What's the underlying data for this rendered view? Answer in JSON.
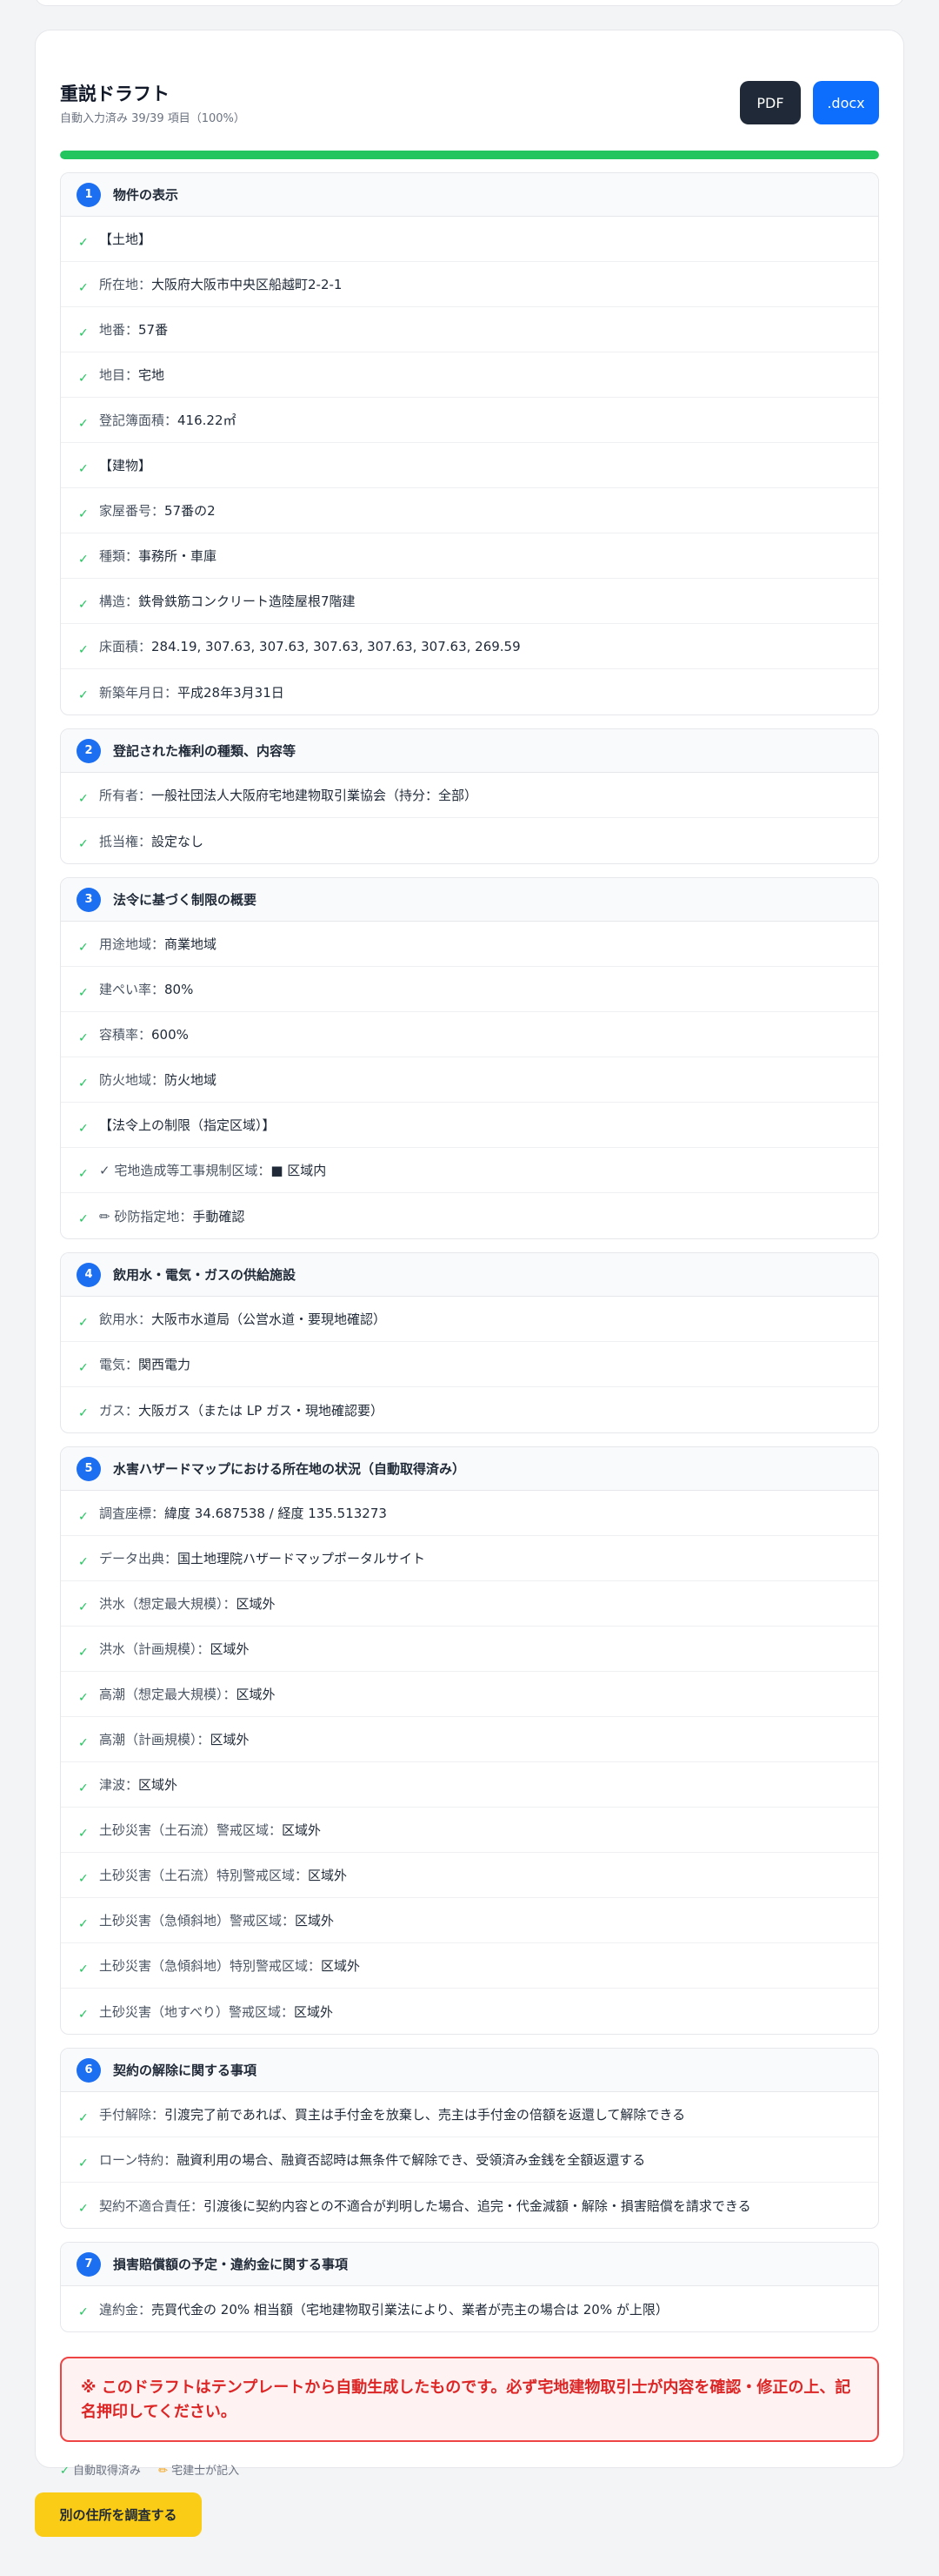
{
  "draft": {
    "title": "重説ドラフト",
    "subtitle": "自動入力済み 39/39 項目（100%）",
    "progress_percent": 100,
    "pdf_label": "PDF",
    "docx_label": ".docx"
  },
  "sections": [
    {
      "num": "1",
      "title": "物件の表示",
      "rows": [
        {
          "text": "【土地】"
        },
        {
          "label": "所在地：",
          "value": "大阪府大阪市中央区船越町2-2-1"
        },
        {
          "label": "地番：",
          "value": "57番"
        },
        {
          "label": "地目：",
          "value": "宅地"
        },
        {
          "label": "登記簿面積：",
          "value": "416.22㎡"
        },
        {
          "text": "【建物】"
        },
        {
          "label": "家屋番号：",
          "value": "57番の2"
        },
        {
          "label": "種類：",
          "value": "事務所・車庫"
        },
        {
          "label": "構造：",
          "value": "鉄骨鉄筋コンクリート造陸屋根7階建"
        },
        {
          "label": "床面積：",
          "value": "284.19, 307.63, 307.63, 307.63, 307.63, 307.63, 269.59"
        },
        {
          "label": "新築年月日：",
          "value": "平成28年3月31日"
        }
      ]
    },
    {
      "num": "2",
      "title": "登記された権利の種類、内容等",
      "rows": [
        {
          "label": "所有者：",
          "value": "一般社団法人大阪府宅地建物取引業協会（持分：全部）"
        },
        {
          "label": "抵当権：",
          "value": "設定なし"
        }
      ]
    },
    {
      "num": "3",
      "title": "法令に基づく制限の概要",
      "rows": [
        {
          "label": "用途地域：",
          "value": "商業地域"
        },
        {
          "label": "建ぺい率：",
          "value": "80%"
        },
        {
          "label": "容積率：",
          "value": "600%"
        },
        {
          "label": "防火地域：",
          "value": "防火地域"
        },
        {
          "text": "【法令上の制限（指定区域）】"
        },
        {
          "label": "✓ 宅地造成等工事規制区域：",
          "value": "■ 区域内"
        },
        {
          "label": "✏ 砂防指定地：",
          "value": "手動確認"
        }
      ]
    },
    {
      "num": "4",
      "title": "飲用水・電気・ガスの供給施設",
      "rows": [
        {
          "label": "飲用水：",
          "value": "大阪市水道局（公営水道・要現地確認）"
        },
        {
          "label": "電気：",
          "value": "関西電力"
        },
        {
          "label": "ガス：",
          "value": "大阪ガス（または LP ガス・現地確認要）"
        }
      ]
    },
    {
      "num": "5",
      "title": "水害ハザードマップにおける所在地の状況（自動取得済み）",
      "rows": [
        {
          "label": "調査座標：",
          "value": "緯度 34.687538 / 経度 135.513273"
        },
        {
          "label": "データ出典：",
          "value": "国土地理院ハザードマップポータルサイト"
        },
        {
          "label": "洪水（想定最大規模）：",
          "value": "区域外"
        },
        {
          "label": "洪水（計画規模）：",
          "value": "区域外"
        },
        {
          "label": "高潮（想定最大規模）：",
          "value": "区域外"
        },
        {
          "label": "高潮（計画規模）：",
          "value": "区域外"
        },
        {
          "label": "津波：",
          "value": "区域外"
        },
        {
          "label": "土砂災害（土石流）警戒区域：",
          "value": "区域外"
        },
        {
          "label": "土砂災害（土石流）特別警戒区域：",
          "value": "区域外"
        },
        {
          "label": "土砂災害（急傾斜地）警戒区域：",
          "value": "区域外"
        },
        {
          "label": "土砂災害（急傾斜地）特別警戒区域：",
          "value": "区域外"
        },
        {
          "label": "土砂災害（地すべり）警戒区域：",
          "value": "区域外"
        }
      ]
    },
    {
      "num": "6",
      "title": "契約の解除に関する事項",
      "rows": [
        {
          "label": "手付解除：",
          "value": "引渡完了前であれば、買主は手付金を放棄し、売主は手付金の倍額を返還して解除できる"
        },
        {
          "label": "ローン特約：",
          "value": "融資利用の場合、融資否認時は無条件で解除でき、受領済み金銭を全額返還する"
        },
        {
          "label": "契約不適合責任：",
          "value": "引渡後に契約内容との不適合が判明した場合、追完・代金減額・解除・損害賠償を請求できる"
        }
      ]
    },
    {
      "num": "7",
      "title": "損害賠償額の予定・違約金に関する事項",
      "rows": [
        {
          "label": "違約金：",
          "value": "売買代金の 20% 相当額（宅地建物取引業法により、業者が売主の場合は 20% が上限）"
        }
      ]
    }
  ],
  "warning_text": "※ このドラフトはテンプレートから自動生成したものです。必ず宅地建物取引士が内容を確認・修正の上、記名押印してください。",
  "legend": {
    "auto_label": "自動取得済み",
    "manual_label": "宅建士が記入"
  },
  "bottom_button_label": "別の住所を調査する",
  "icons": {
    "check": "check-icon",
    "pencil": "pencil-icon"
  },
  "colors": {
    "accent_blue": "#1d6ff2",
    "progress_green": "#22c55e",
    "warning_red": "#dc2626",
    "bottom_button_yellow": "#facc15",
    "pdf_button": "#1f2937",
    "docx_button": "#0d6efd"
  }
}
